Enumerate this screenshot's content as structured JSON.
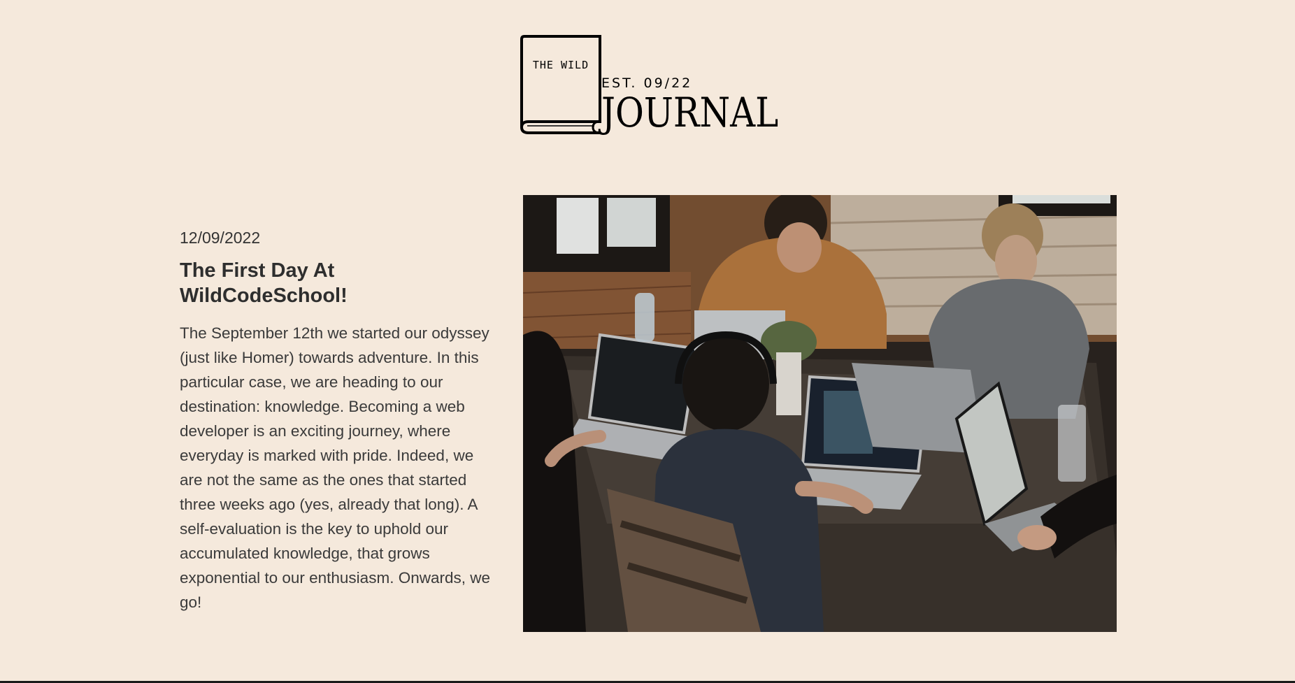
{
  "logo": {
    "book_text": "THE WILD",
    "est_text": "EST. 09/22",
    "title_text": "JOURNAL",
    "icon": "book-icon"
  },
  "article": {
    "date": "12/09/2022",
    "title": "The First Day At WildCodeSchool!",
    "body": "The September 12th we started our odyssey (just like Homer) towards adventure. In this particular case, we are heading to our destination: knowledge. Becoming a web developer is an exciting journey, where everyday is marked with pride. Indeed, we are not the same as the ones that started three weeks ago (yes, already that long). A self-evaluation is the key to uphold our accumulated knowledge, that grows exponential to our enthusiasm. Onwards, we go!",
    "image_subject": "students-working-on-laptops-photo"
  },
  "colors": {
    "background": "#f5e9dc",
    "text": "#333333",
    "logo": "#000000"
  }
}
